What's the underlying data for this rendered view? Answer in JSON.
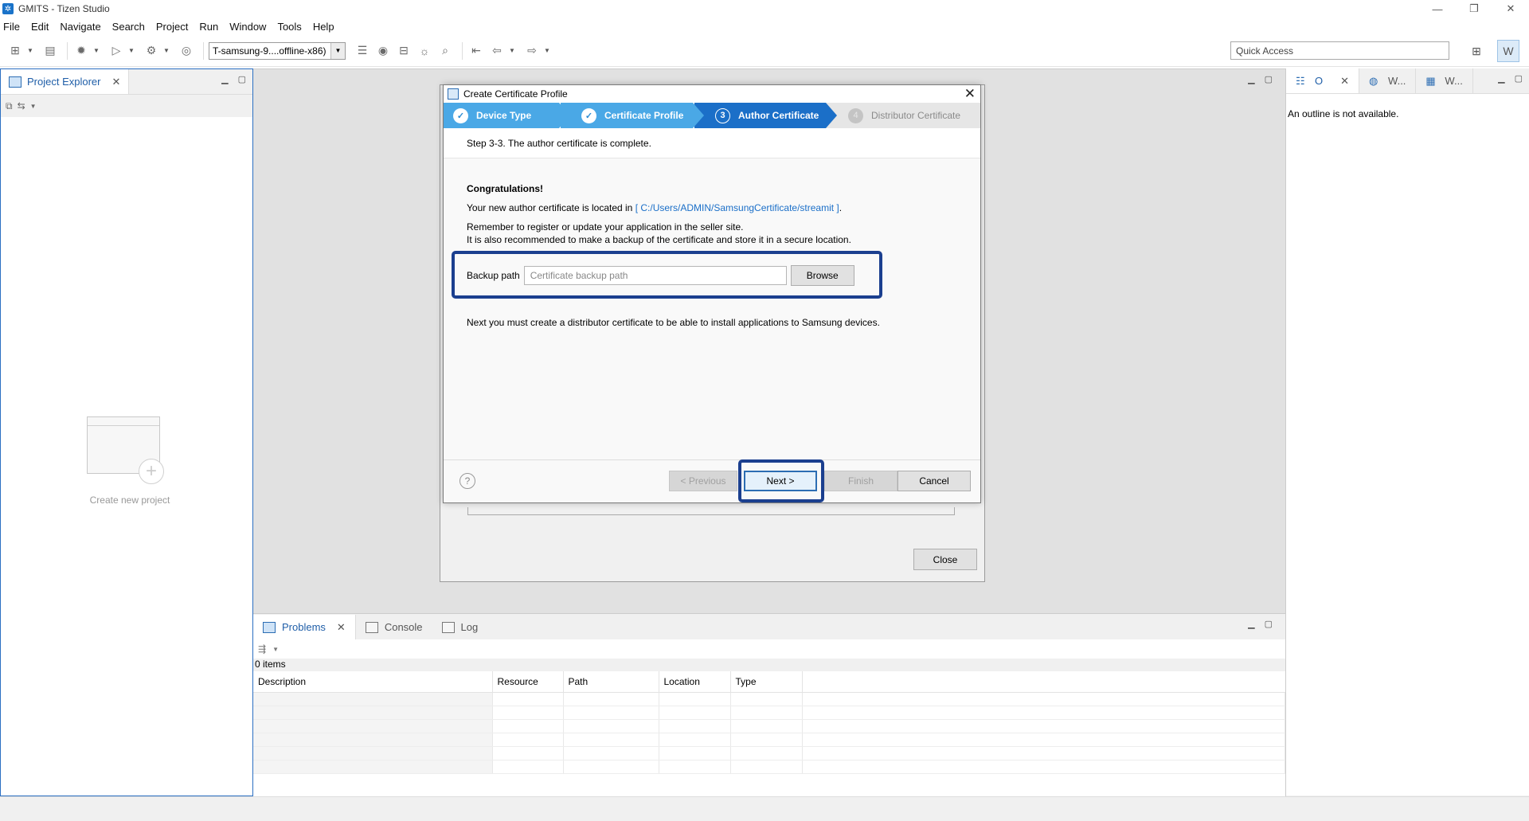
{
  "window": {
    "title": "GMITS - Tizen Studio",
    "app_icon": "tizen-icon"
  },
  "menu": {
    "items": [
      "File",
      "Edit",
      "Navigate",
      "Search",
      "Project",
      "Run",
      "Window",
      "Tools",
      "Help"
    ]
  },
  "toolbar": {
    "device_select": "T-samsung-9....offline-x86)",
    "quick_access_placeholder": "Quick Access"
  },
  "project_explorer": {
    "tab_label": "Project Explorer",
    "create_label": "Create new project"
  },
  "outline": {
    "tab_label": "O",
    "tab2_label": "W...",
    "tab3_label": "W...",
    "message": "An outline is not available."
  },
  "bottom": {
    "tabs": [
      "Problems",
      "Console",
      "Log"
    ],
    "count": "0 items",
    "columns": [
      "Description",
      "Resource",
      "Path",
      "Location",
      "Type"
    ]
  },
  "bg_dialog": {
    "close_label": "Close"
  },
  "dialog": {
    "title": "Create Certificate Profile",
    "steps": [
      {
        "label": "Device Type",
        "state": "done",
        "num": "✓"
      },
      {
        "label": "Certificate Profile",
        "state": "done",
        "num": "✓"
      },
      {
        "label": "Author Certificate",
        "state": "current",
        "num": "3"
      },
      {
        "label": "Distributor Certificate",
        "state": "todo",
        "num": "4"
      }
    ],
    "header": "Step 3-3. The author certificate is complete.",
    "congrats": "Congratulations!",
    "location_prefix": "Your new author certificate is located in ",
    "location_path": "[ C:/Users/ADMIN/SamsungCertificate/streamit ]",
    "location_suffix": ".",
    "remember_line1": "Remember to register or update your application in the seller site.",
    "remember_line2": "It is also recommended to make a backup of the certificate and store it in a secure location.",
    "backup_label": "Backup path",
    "backup_placeholder": "Certificate backup path",
    "browse_label": "Browse",
    "next_info": "Next you must create a distributor certificate to be able to install applications to Samsung devices.",
    "help_label": "?",
    "previous_label": "< Previous",
    "next_label": "Next >",
    "finish_label": "Finish",
    "cancel_label": "Cancel"
  },
  "colors": {
    "accent": "#1b6fc8",
    "step_done": "#4aa8e6",
    "highlight": "#1b3f8f"
  }
}
